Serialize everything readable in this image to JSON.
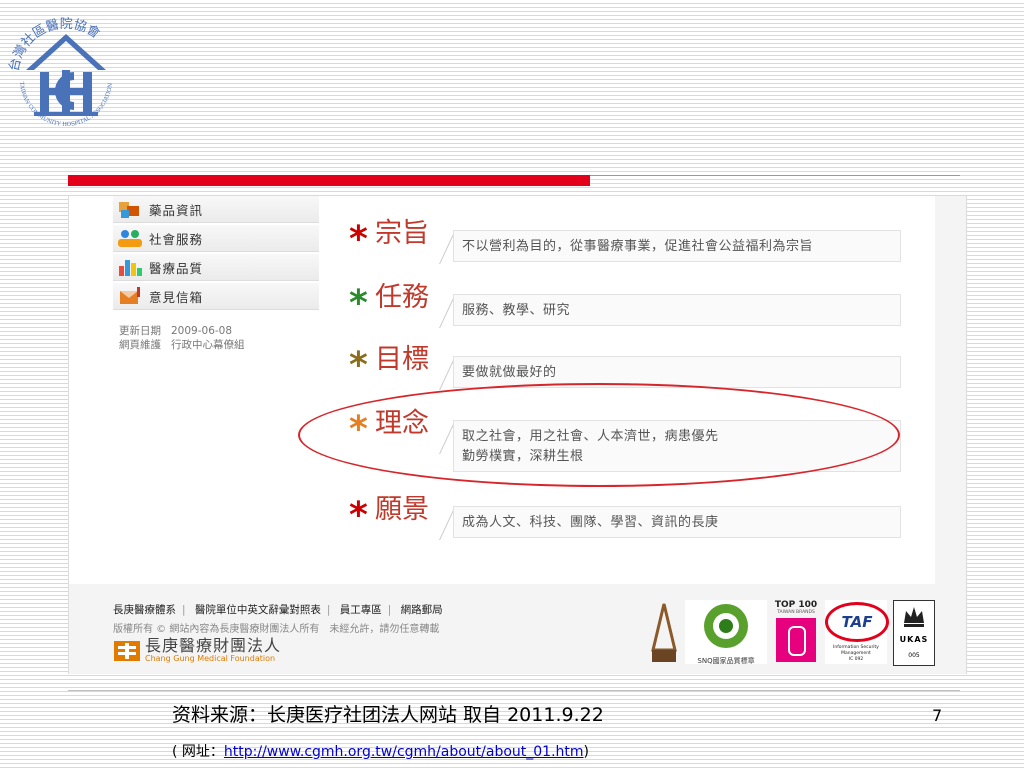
{
  "logo": {
    "ring_text_cn": "台灣社區醫院協會",
    "ring_text_en": "TAIWAN COMMUNITY HOSPITAL ASSOCIATION",
    "color": "#4a72b8"
  },
  "accent": {
    "red": "#e2001a",
    "title_red": "#c0392b"
  },
  "sidebar": {
    "items": [
      {
        "label": "藥品資訊",
        "icon": "medicine-icon"
      },
      {
        "label": "社會服務",
        "icon": "community-icon"
      },
      {
        "label": "醫療品質",
        "icon": "quality-chart-icon"
      },
      {
        "label": "意見信箱",
        "icon": "mailbox-icon"
      }
    ],
    "updated_label": "更新日期",
    "updated_value": "2009-06-08",
    "maintainer_label": "網頁維護",
    "maintainer_value": "行政中心幕僚組"
  },
  "mission": [
    {
      "title": "宗旨",
      "text": "不以營利為目的，從事醫療事業，促進社會公益福利為宗旨"
    },
    {
      "title": "任務",
      "text": "服務、教學、研究"
    },
    {
      "title": "目標",
      "text": "要做就做最好的"
    },
    {
      "title": "理念",
      "text": "取之社會，用之社會、人本濟世，病患優先",
      "text2": "勤勞樸實，深耕生根"
    },
    {
      "title": "願景",
      "text": "成為人文、科技、團隊、學習、資訊的長庚"
    }
  ],
  "footer": {
    "links": [
      "長庚醫療體系",
      "醫院單位中英文辭彙對照表",
      "員工專區",
      "網路郵局"
    ],
    "copyright": "版權所有 © 網站內容為長庚醫療財團法人所有　未經允許，請勿任意轉載",
    "org_name": "長庚醫療財團法人",
    "org_name_en": "Chang Gung Medical Foundation",
    "badges": {
      "snq": "SNQ國家品質標章",
      "top100_title": "TOP 100",
      "top100_sub": "TAIWAN BRANDS",
      "taf": "TAF",
      "taf_sub": "Information Security Management",
      "taf_code": "IC 092",
      "ukas": "UKAS",
      "ukas_code": "005"
    }
  },
  "caption": {
    "source": "资料来源：长庚医疗社团法人网站  取自 ",
    "date": "2011.9.22",
    "url_prefix": "( 网址：",
    "url": "http://www.cgmh.org.tw/cgmh/about/about_01.htm",
    "url_suffix": ")",
    "page_number": "7"
  }
}
